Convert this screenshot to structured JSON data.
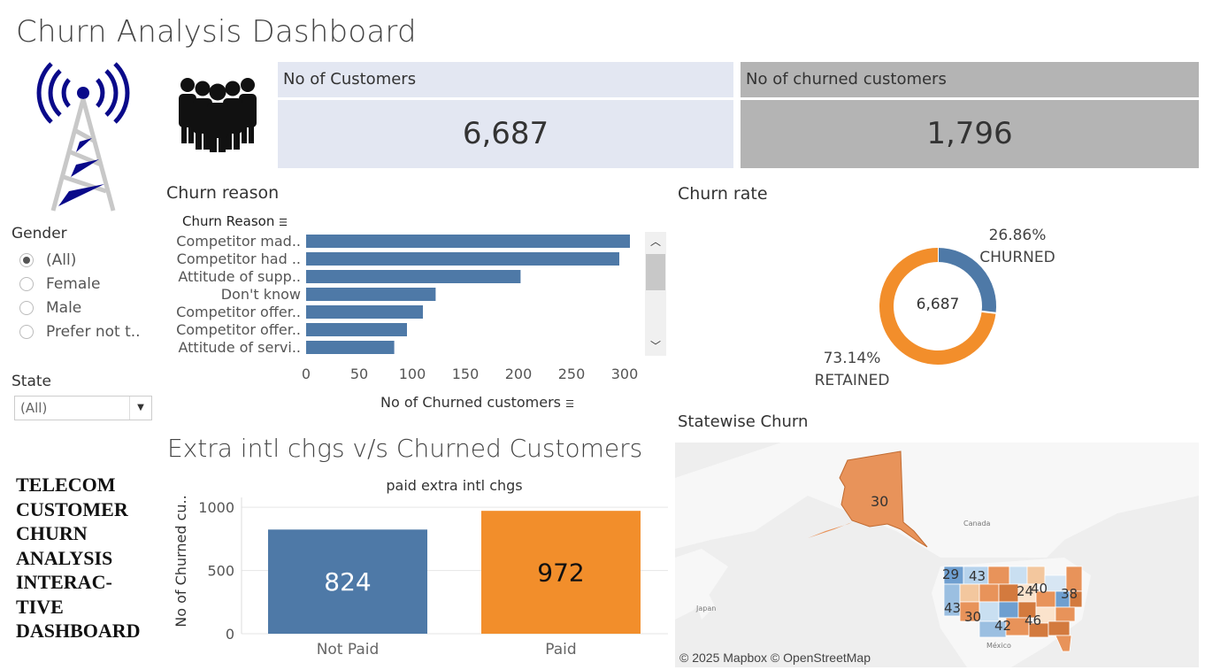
{
  "header": {
    "title": "Churn Analysis Dashboard"
  },
  "kpis": {
    "customers": {
      "label": "No of Customers",
      "value": "6,687"
    },
    "churned": {
      "label": "No of churned customers",
      "value": "1,796"
    }
  },
  "filters": {
    "gender": {
      "label": "Gender",
      "options": [
        "(All)",
        "Female",
        "Male",
        "Prefer not t.."
      ],
      "selected": "(All)"
    },
    "state": {
      "label": "State",
      "value": "(All)"
    }
  },
  "side_text": "TELECOM CUSTOMER CHURN ANALYSIS INTERAC-TIVE DASHBOARD",
  "side_text_lines": [
    "TELECOM",
    "CUSTOMER",
    "CHURN",
    "ANALYSIS",
    "INTERAC-",
    "TIVE",
    "DASHBOARD"
  ],
  "churn_reason": {
    "title": "Churn reason",
    "column_header": "Churn Reason",
    "axis_label": "No of Churned customers",
    "ticks": [
      "0",
      "50",
      "100",
      "150",
      "200",
      "250",
      "300"
    ]
  },
  "churn_rate": {
    "title": "Churn rate",
    "center": "6,687",
    "churned_pct": "26.86%",
    "churned_label": "CHURNED",
    "retained_pct": "73.14%",
    "retained_label": "RETAINED"
  },
  "extra_chgs": {
    "title": "Extra intl chgs v/s Churned Customers",
    "subtitle": "paid extra intl chgs",
    "ylabel": "No of Churned cu..",
    "yticks": [
      "1000",
      "500",
      "0"
    ]
  },
  "map": {
    "title": "Statewise Churn",
    "attribution": "© 2025 Mapbox © OpenStreetMap",
    "place_labels": [
      "Canada",
      "Japan",
      "México"
    ],
    "state_values": [
      "30",
      "29",
      "43",
      "24",
      "40",
      "38",
      "43",
      "30",
      "42",
      "46"
    ]
  },
  "colors": {
    "blue": "#4e79a7",
    "orange": "#f28e2b",
    "kpi_light": "#e3e7f2",
    "kpi_gray": "#b4b4b4"
  },
  "chart_data": [
    {
      "type": "bar",
      "orientation": "horizontal",
      "title": "Churn reason",
      "categories": [
        "Competitor mad..",
        "Competitor had ..",
        "Attitude of supp..",
        "Don't know",
        "Competitor offer..",
        "Competitor offer..",
        "Attitude of servi.."
      ],
      "values": [
        305,
        295,
        202,
        122,
        110,
        95,
        83
      ],
      "xlabel": "No of Churned customers",
      "ylabel": "Churn Reason",
      "xlim": [
        0,
        320
      ]
    },
    {
      "type": "pie",
      "title": "Churn rate",
      "categories": [
        "CHURNED",
        "RETAINED"
      ],
      "values": [
        26.86,
        73.14
      ],
      "total": 6687
    },
    {
      "type": "bar",
      "title": "Extra intl chgs v/s Churned Customers",
      "subtitle": "paid extra intl chgs",
      "categories": [
        "Not Paid",
        "Paid"
      ],
      "values": [
        824,
        972
      ],
      "ylabel": "No of Churned cu..",
      "ylim": [
        0,
        1000
      ]
    }
  ]
}
